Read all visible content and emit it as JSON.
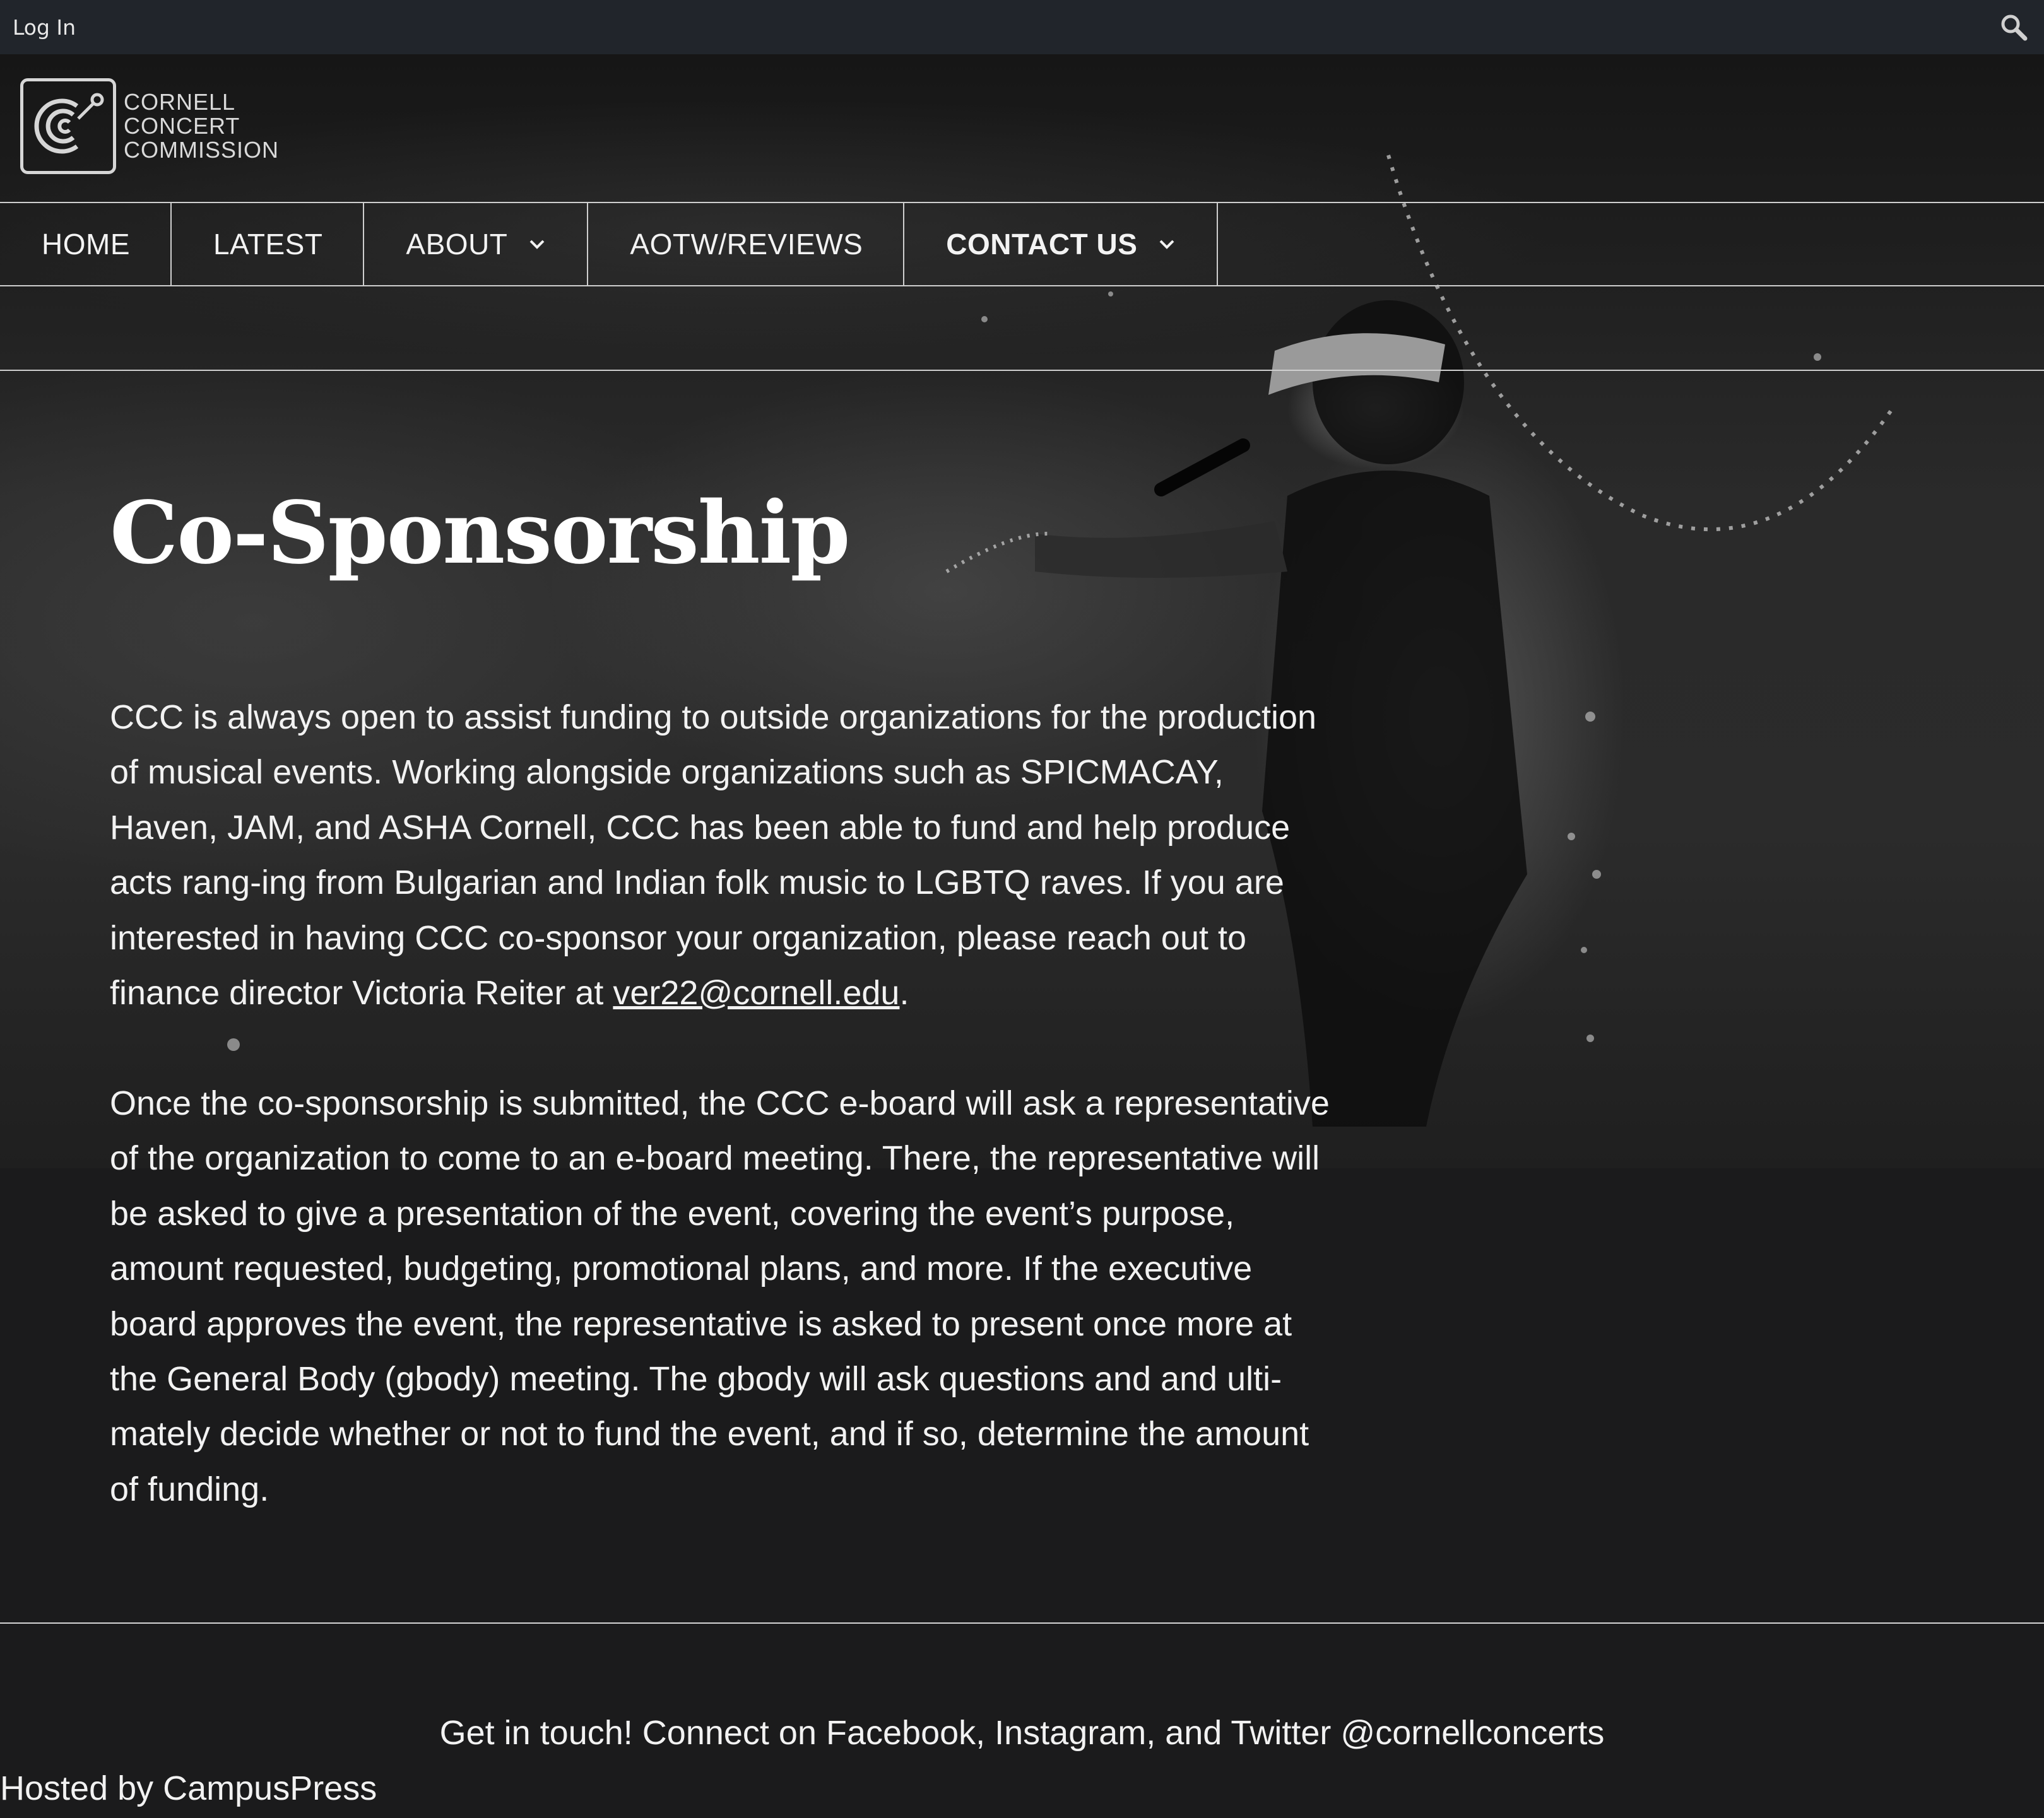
{
  "adminbar": {
    "login_label": "Log In",
    "search_icon": "search-icon"
  },
  "logo": {
    "line1": "CORNELL",
    "line2": "CONCERT",
    "line3": "COMMISSION",
    "icon": "ccc-logo-icon"
  },
  "nav": {
    "items": [
      {
        "label": "HOME"
      },
      {
        "label": "LATEST"
      },
      {
        "label": "ABOUT"
      },
      {
        "label": "AOTW/REVIEWS"
      },
      {
        "label": "CONTACT US"
      }
    ]
  },
  "main": {
    "title": "Co-Sponsorship",
    "para1_text": "CCC is always open to assist funding to outside organizations for the production of musical events. Working alongside organizations such as SPICMACAY, Haven, JAM, and ASHA Cornell, CCC has been able to fund and help produce acts rang-ing from Bulgarian and Indian folk music to LGBTQ raves. If you are interested in having CCC co-sponsor your organization, please reach out to finance director Victoria Reiter at ",
    "para1_email": "ver22@cornell.edu",
    "para1_end": ".",
    "para2_text": "Once the co-sponsorship is submitted, the CCC e-board will ask a representative of the organization to come to an e-board meeting. There, the representative will be asked to give a presentation of the event, covering the event’s purpose, amount requested, budgeting, promotional plans, and more. If the executive board approves the event, the representative is asked to present once more at the General Body (gbody) meeting. The gbody will ask questions and and ulti-mately decide whether or not to fund the event, and if so, determine the amount of funding."
  },
  "footer": {
    "connect_text": "Get in touch! Connect on Facebook, Instagram, and Twitter @cornellconcerts",
    "hosted_text": "Hosted by CampusPress"
  },
  "colors": {
    "background": "#1b1b1c",
    "adminbar": "#21252b",
    "text": "#f2f2f2",
    "rule": "#cfcfcf"
  }
}
